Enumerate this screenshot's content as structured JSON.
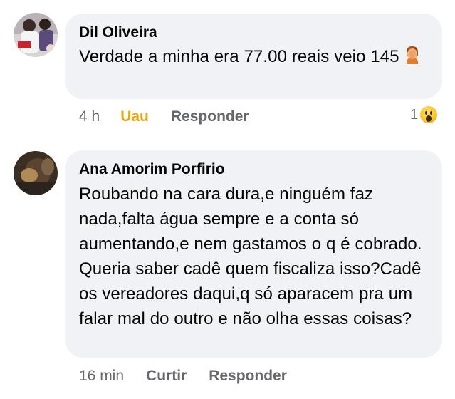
{
  "comments": [
    {
      "author": "Dil Oliveira",
      "text": "Verdade a minha era 77.00 reais veio 145",
      "time": "4 h",
      "reaction_label": "Uau",
      "reply_label": "Responder",
      "reaction_count": "1",
      "reaction_icon": "wow-emoji-icon",
      "inline_emoji": "facepalm-emoji-icon"
    },
    {
      "author": "Ana Amorim Porfirio",
      "text": "Roubando na cara dura,e ninguém faz nada,falta água sempre e a conta só aumentando,e nem gastamos o q é cobrado. Queria saber cadê quem fiscaliza isso?Cadê os vereadores daqui,q só aparacem pra um falar mal do outro e não olha essas coisas?",
      "time": "16 min",
      "like_label": "Curtir",
      "reply_label": "Responder"
    }
  ],
  "colors": {
    "bubble": "#f0f2f5",
    "meta": "#65676b",
    "wow_reaction": "#e6a817"
  }
}
